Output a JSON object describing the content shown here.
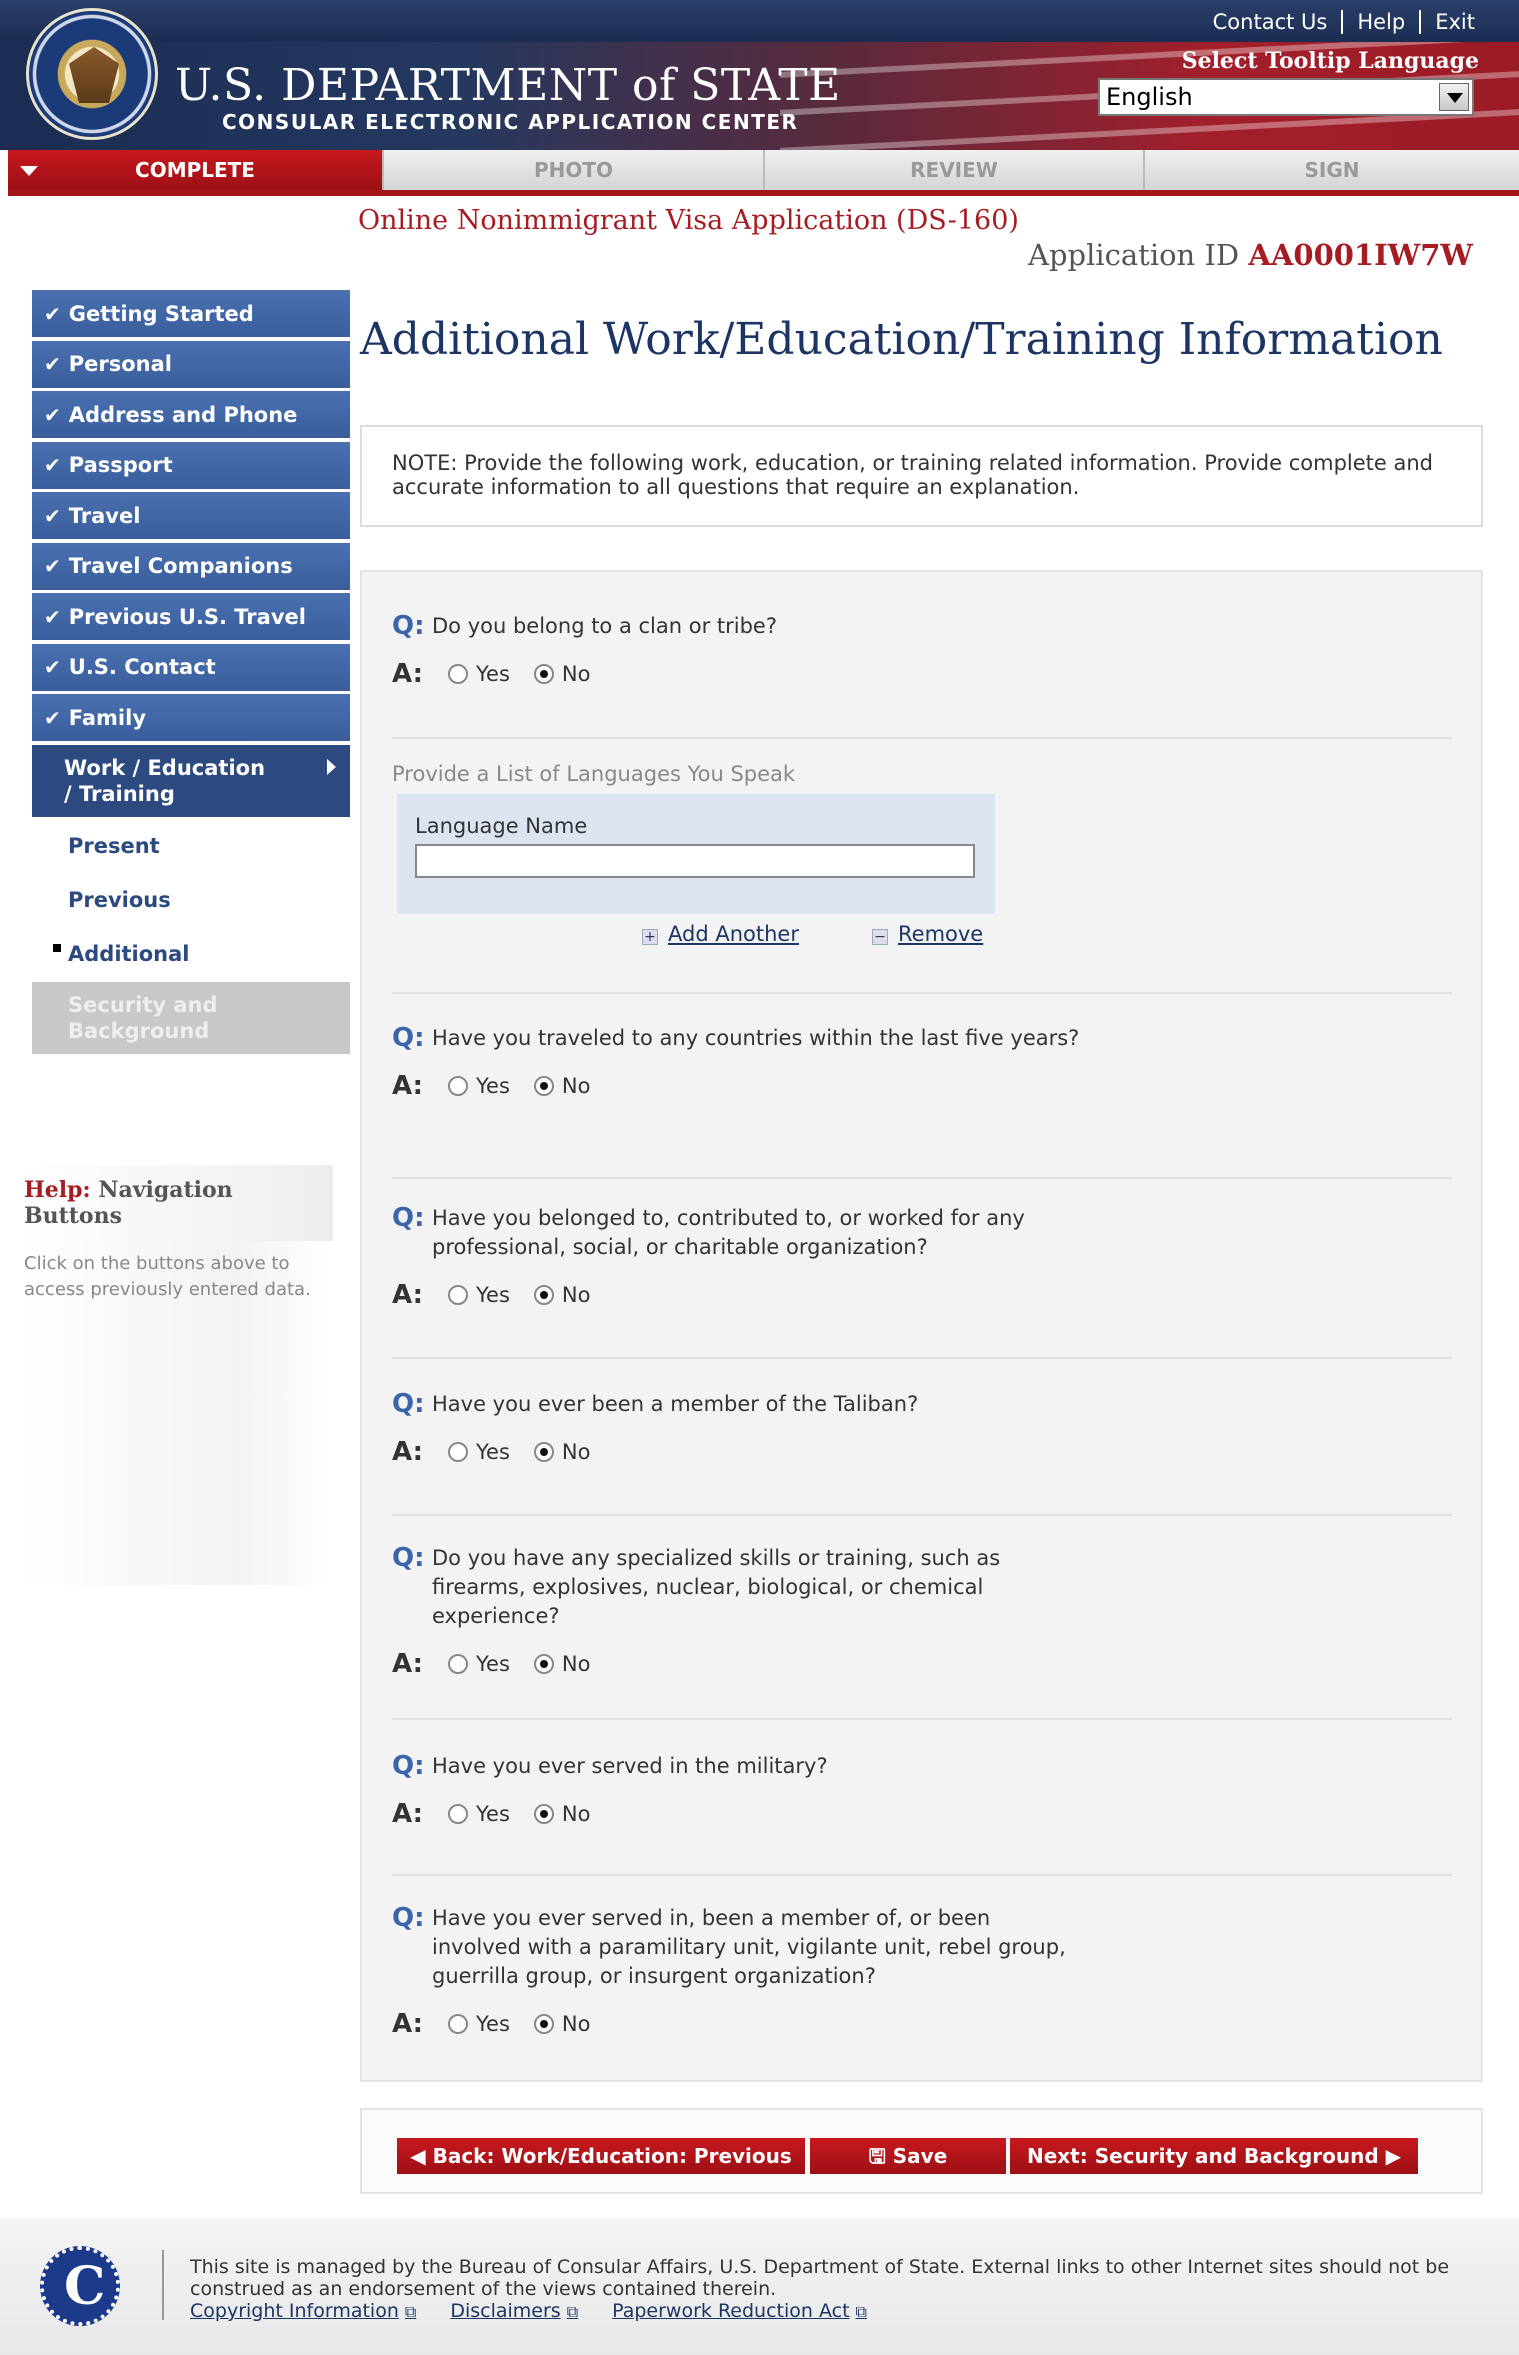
{
  "header": {
    "links": [
      "Contact Us",
      "Help",
      "Exit"
    ],
    "dept_title": "U.S. DEPARTMENT of STATE",
    "dept_subtitle": "CONSULAR ELECTRONIC APPLICATION CENTER",
    "tooltip_label": "Select Tooltip Language",
    "tooltip_language": "English"
  },
  "steps": [
    {
      "label": "COMPLETE",
      "active": true
    },
    {
      "label": "PHOTO",
      "active": false
    },
    {
      "label": "REVIEW",
      "active": false
    },
    {
      "label": "SIGN",
      "active": false
    }
  ],
  "app": {
    "title": "Online Nonimmigrant Visa Application (DS-160)",
    "id_label": "Application ID",
    "id_value": "AA0001IW7W"
  },
  "sidebar": {
    "items": [
      "Getting Started",
      "Personal",
      "Address and Phone",
      "Passport",
      "Travel",
      "Travel Companions",
      "Previous U.S. Travel",
      "U.S. Contact",
      "Family"
    ],
    "current": "Work / Education / Training",
    "sub_items": [
      "Present",
      "Previous",
      "Additional"
    ],
    "disabled": "Security and Background"
  },
  "help": {
    "title_prefix": "Help:",
    "title": "Navigation Buttons",
    "text": "Click on the buttons above to access previously entered data."
  },
  "main": {
    "page_title": "Additional Work/Education/Training Information",
    "note": "NOTE: Provide the following work, education, or training related information. Provide complete and accurate information to all questions that require an explanation.",
    "q_marker": "Q:",
    "a_marker": "A:",
    "yes_label": "Yes",
    "no_label": "No",
    "questions": [
      {
        "text": "Do you belong to a clan or tribe?",
        "answer": "No"
      },
      {
        "text": "Have you traveled to any countries within the last five years?",
        "answer": "No"
      },
      {
        "text": "Have you belonged to, contributed to, or worked for any professional, social, or charitable organization?",
        "answer": "No"
      },
      {
        "text": "Have you ever been a member of the Taliban?",
        "answer": "No"
      },
      {
        "text": "Do you have any specialized skills or training, such as firearms, explosives, nuclear, biological, or chemical experience?",
        "answer": "No"
      },
      {
        "text": "Have you ever served in the military?",
        "answer": "No"
      },
      {
        "text": "Have you ever served in, been a member of, or been involved with a paramilitary unit, vigilante unit, rebel group, guerrilla group, or insurgent organization?",
        "answer": "No"
      }
    ],
    "languages": {
      "section_label": "Provide a List of Languages You Speak",
      "field_label": "Language Name",
      "value": "",
      "add_label": "Add Another",
      "remove_label": "Remove"
    }
  },
  "buttons": {
    "back": "Back: Work/Education: Previous",
    "save": "Save",
    "next": "Next: Security and Background"
  },
  "footer": {
    "text": "This site is managed by the Bureau of Consular Affairs, U.S. Department of State. External links to other Internet sites should not be construed as an endorsement of the views contained therein.",
    "links": [
      "Copyright Information",
      "Disclaimers",
      "Paperwork Reduction Act"
    ],
    "logo_letter": "C"
  }
}
